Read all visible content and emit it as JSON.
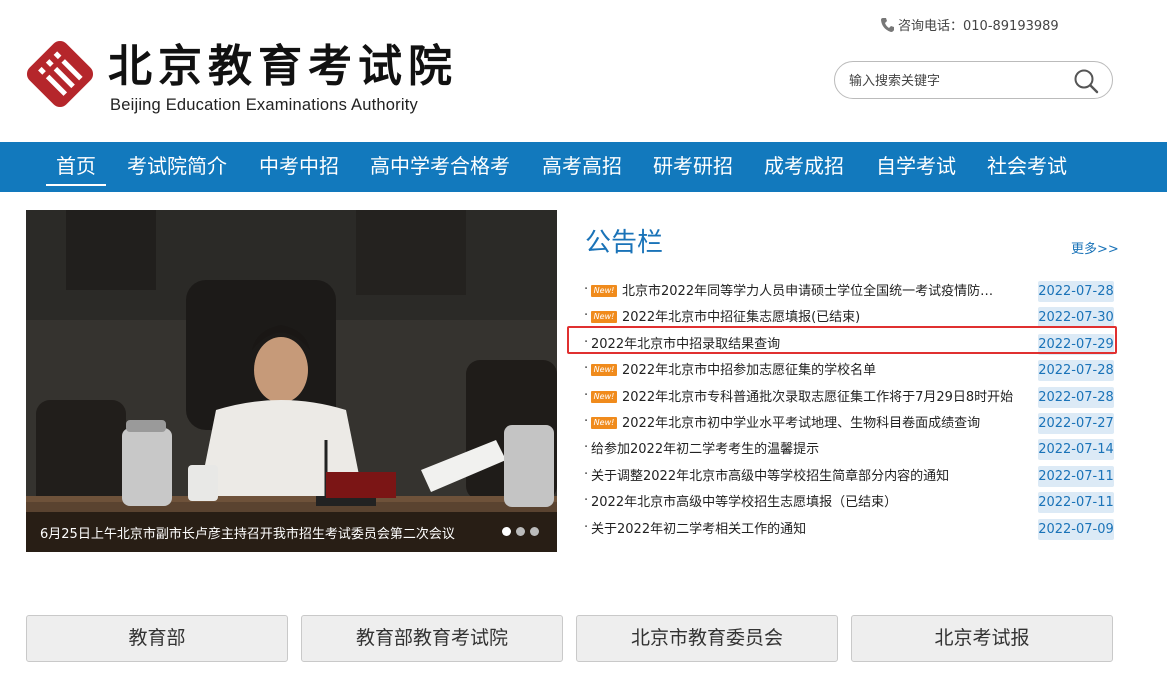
{
  "header": {
    "logo_cn": "北京教育考试院",
    "logo_en": "Beijing Education Examinations Authority",
    "phone": "咨询电话：010-89193989",
    "search_placeholder": "输入搜索关键字",
    "brand_color": "#b5262b"
  },
  "nav": {
    "items": [
      {
        "label": "首页",
        "active": true
      },
      {
        "label": "考试院简介"
      },
      {
        "label": "中考中招"
      },
      {
        "label": "高中学考合格考"
      },
      {
        "label": "高考高招"
      },
      {
        "label": "研考研招"
      },
      {
        "label": "成考成招"
      },
      {
        "label": "自学考试"
      },
      {
        "label": "社会考试"
      }
    ],
    "color": "#1279bd"
  },
  "slide": {
    "caption": "6月25日上午北京市副市长卢彦主持召开我市招生考试委员会第二次会议",
    "dots": 3,
    "active_dot": 0
  },
  "board": {
    "title": "公告栏",
    "more": "更多>>",
    "new_badge": "New!",
    "items": [
      {
        "bullet": "·",
        "title": "北京市2022年同等学力人员申请硕士学位全国统一考试疫情防控...",
        "date": "2022-07-28",
        "new": true
      },
      {
        "bullet": "·",
        "title": "2022年北京市中招征集志愿填报(已结束)",
        "date": "2022-07-30",
        "new": true
      },
      {
        "bullet": "·",
        "title": "2022年北京市中招录取结果查询",
        "date": "2022-07-29",
        "new": false,
        "highlighted": true
      },
      {
        "bullet": "·",
        "title": "2022年北京市中招参加志愿征集的学校名单",
        "date": "2022-07-28",
        "new": true
      },
      {
        "bullet": "·",
        "title": "2022年北京市专科普通批次录取志愿征集工作将于7月29日8时开始",
        "date": "2022-07-28",
        "new": true
      },
      {
        "bullet": "·",
        "title": "2022年北京市初中学业水平考试地理、生物科目卷面成绩查询",
        "date": "2022-07-27",
        "new": true
      },
      {
        "bullet": "·",
        "title": "给参加2022年初二学考考生的温馨提示",
        "date": "2022-07-14",
        "new": false
      },
      {
        "bullet": "·",
        "title": "关于调整2022年北京市高级中等学校招生简章部分内容的通知",
        "date": "2022-07-11",
        "new": false
      },
      {
        "bullet": "·",
        "title": "2022年北京市高级中等学校招生志愿填报（已结束）",
        "date": "2022-07-11",
        "new": false
      },
      {
        "bullet": "·",
        "title": "关于2022年初二学考相关工作的通知",
        "date": "2022-07-09",
        "new": false
      }
    ]
  },
  "links": [
    {
      "label": "教育部"
    },
    {
      "label": "教育部教育考试院"
    },
    {
      "label": "北京市教育委员会"
    },
    {
      "label": "北京考试报"
    }
  ]
}
